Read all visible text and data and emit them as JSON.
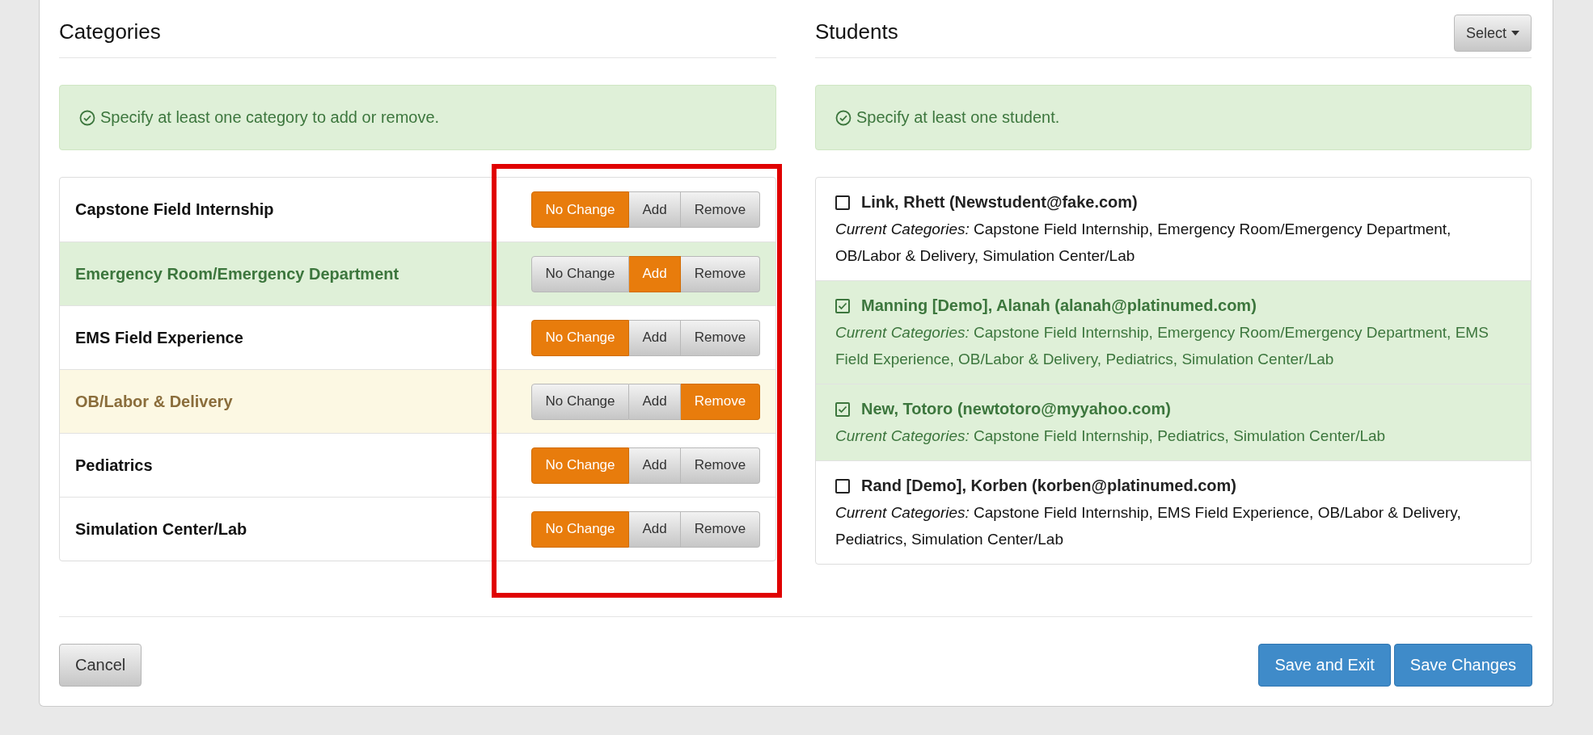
{
  "categories_panel": {
    "title": "Categories",
    "alert": "Specify at least one category to add or remove.",
    "items": [
      {
        "name": "Capstone Field Internship",
        "options": [
          {
            "kind": "no_change",
            "label": "No Change",
            "selected": true
          },
          {
            "kind": "add",
            "label": "Add",
            "selected": false
          },
          {
            "kind": "remove",
            "label": "Remove",
            "selected": false
          }
        ]
      },
      {
        "name": "Emergency Room/Emergency Department",
        "options": [
          {
            "kind": "no_change",
            "label": "No Change",
            "selected": false
          },
          {
            "kind": "add",
            "label": "Add",
            "selected": true
          },
          {
            "kind": "remove",
            "label": "Remove",
            "selected": false
          }
        ]
      },
      {
        "name": "EMS Field Experience",
        "options": [
          {
            "kind": "no_change",
            "label": "No Change",
            "selected": true
          },
          {
            "kind": "add",
            "label": "Add",
            "selected": false
          },
          {
            "kind": "remove",
            "label": "Remove",
            "selected": false
          }
        ]
      },
      {
        "name": "OB/Labor & Delivery",
        "options": [
          {
            "kind": "no_change",
            "label": "No Change",
            "selected": false
          },
          {
            "kind": "add",
            "label": "Add",
            "selected": false
          },
          {
            "kind": "remove",
            "label": "Remove",
            "selected": true
          }
        ]
      },
      {
        "name": "Pediatrics",
        "options": [
          {
            "kind": "no_change",
            "label": "No Change",
            "selected": true
          },
          {
            "kind": "add",
            "label": "Add",
            "selected": false
          },
          {
            "kind": "remove",
            "label": "Remove",
            "selected": false
          }
        ]
      },
      {
        "name": "Simulation Center/Lab",
        "options": [
          {
            "kind": "no_change",
            "label": "No Change",
            "selected": true
          },
          {
            "kind": "add",
            "label": "Add",
            "selected": false
          },
          {
            "kind": "remove",
            "label": "Remove",
            "selected": false
          }
        ]
      }
    ]
  },
  "students_panel": {
    "title": "Students",
    "select_button": "Select",
    "alert": "Specify at least one student.",
    "students": [
      {
        "name": "Link, Rhett (Newstudent@fake.com)",
        "checked": false,
        "categories": "*Current Categories:* Capstone Field Internship, Emergency Room/Emergency Department, OB/Labor & Delivery, Simulation Center/Lab"
      },
      {
        "name": "Manning [Demo], Alanah (alanah@platinumed.com)",
        "checked": true,
        "categories": "*Current Categories:* Capstone Field Internship, Emergency Room/Emergency Department, EMS Field Experience, OB/Labor & Delivery, Pediatrics, Simulation Center/Lab"
      },
      {
        "name": "New, Totoro (newtotoro@myyahoo.com)",
        "checked": true,
        "categories": "*Current Categories:* Capstone Field Internship, Pediatrics, Simulation Center/Lab"
      },
      {
        "name": "Rand [Demo], Korben (korben@platinumed.com)",
        "checked": false,
        "categories": "*Current Categories:* Capstone Field Internship, EMS Field Experience, OB/Labor & Delivery, Pediatrics, Simulation Center/Lab"
      }
    ]
  },
  "footer": {
    "cancel": "Cancel",
    "save_exit": "Save and Exit",
    "save_changes": "Save Changes"
  }
}
